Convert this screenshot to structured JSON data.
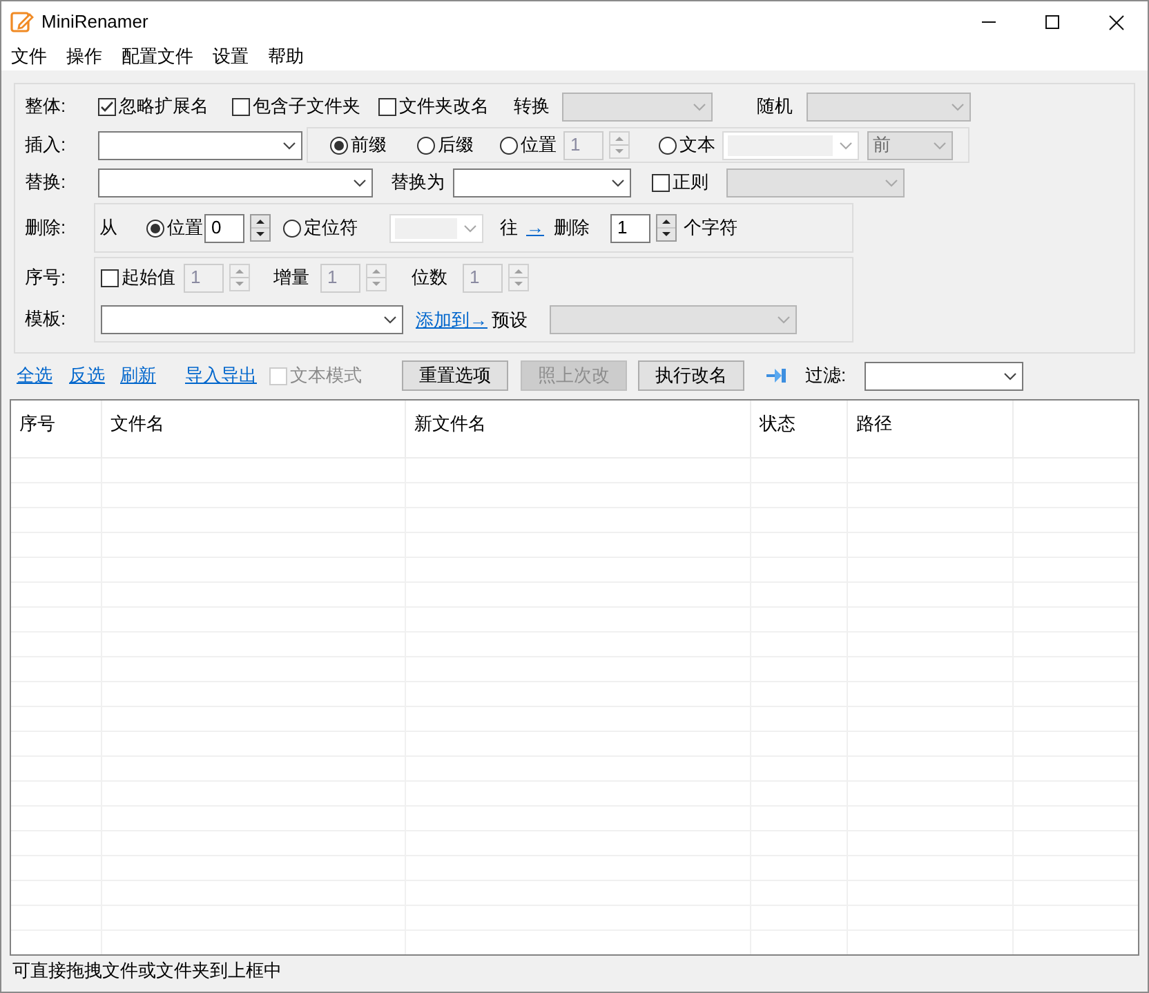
{
  "window": {
    "title": "MiniRenamer"
  },
  "menu": [
    {
      "label": "文件"
    },
    {
      "label": "操作"
    },
    {
      "label": "配置文件"
    },
    {
      "label": "设置"
    },
    {
      "label": "帮助"
    }
  ],
  "whole": {
    "label": "整体:",
    "ignore_extension": {
      "label": "忽略扩展名",
      "checked": true
    },
    "include_subfolders": {
      "label": "包含子文件夹",
      "checked": false
    },
    "rename_folders": {
      "label": "文件夹改名",
      "checked": false
    },
    "convert_label": "转换",
    "convert": {
      "kind": "dropdown",
      "disabled": true
    },
    "random_label": "随机",
    "random": {
      "kind": "dropdown",
      "disabled": true
    }
  },
  "insert": {
    "label": "插入:",
    "text": {
      "kind": "dropdown",
      "disabled": false
    },
    "modes": [
      {
        "label": "前缀",
        "selected": true
      },
      {
        "label": "后缀",
        "selected": false
      },
      {
        "label": "位置",
        "selected": false
      },
      {
        "label": "文本",
        "selected": false
      }
    ],
    "position": {
      "value": "1",
      "disabled": true
    },
    "text_source": {
      "kind": "editable",
      "disabled": true
    },
    "side": {
      "kind": "dropdown",
      "value": "前",
      "disabled": true
    }
  },
  "replace": {
    "label": "替换:",
    "find": {
      "kind": "dropdown",
      "disabled": false
    },
    "with_label": "替换为",
    "with": {
      "kind": "dropdown",
      "disabled": false
    },
    "regex": {
      "label": "正则",
      "checked": false
    },
    "regex_preset": {
      "kind": "dropdown",
      "disabled": true
    }
  },
  "delete": {
    "label": "删除:",
    "from_label": "从",
    "modes": [
      {
        "label": "位置",
        "selected": true
      },
      {
        "label": "定位符",
        "selected": false
      }
    ],
    "position": {
      "value": "0",
      "disabled": false
    },
    "marker": {
      "kind": "editable",
      "disabled": true
    },
    "direction_label": "往",
    "direction": "→",
    "delete_label": "删除",
    "count": {
      "value": "1",
      "disabled": false
    },
    "unit_label": "个字符"
  },
  "sequence": {
    "label": "序号:",
    "start": {
      "label": "起始值",
      "checked": false
    },
    "start_value": {
      "value": "1",
      "disabled": true
    },
    "step_label": "增量",
    "step": {
      "value": "1",
      "disabled": true
    },
    "digits_label": "位数",
    "digits": {
      "value": "1",
      "disabled": true
    }
  },
  "template": {
    "label": "模板:",
    "input": {
      "kind": "dropdown",
      "disabled": false
    },
    "add_link": "添加到→",
    "preset_label": "预设",
    "preset": {
      "kind": "dropdown",
      "disabled": true
    }
  },
  "toolbar": {
    "links": [
      "全选",
      "反选",
      "刷新",
      "导入导出"
    ],
    "text_mode": {
      "label": "文本模式",
      "checked": false,
      "disabled": true
    },
    "buttons": [
      {
        "label": "重置选项",
        "disabled": false
      },
      {
        "label": "照上次改",
        "disabled": true
      },
      {
        "label": "执行改名",
        "disabled": false
      }
    ],
    "filter_label": "过滤:",
    "filter": {
      "kind": "dropdown",
      "disabled": false
    }
  },
  "table": {
    "columns": [
      "序号",
      "文件名",
      "新文件名",
      "状态",
      "路径"
    ]
  },
  "status_bar": "可直接拖拽文件或文件夹到上框中"
}
